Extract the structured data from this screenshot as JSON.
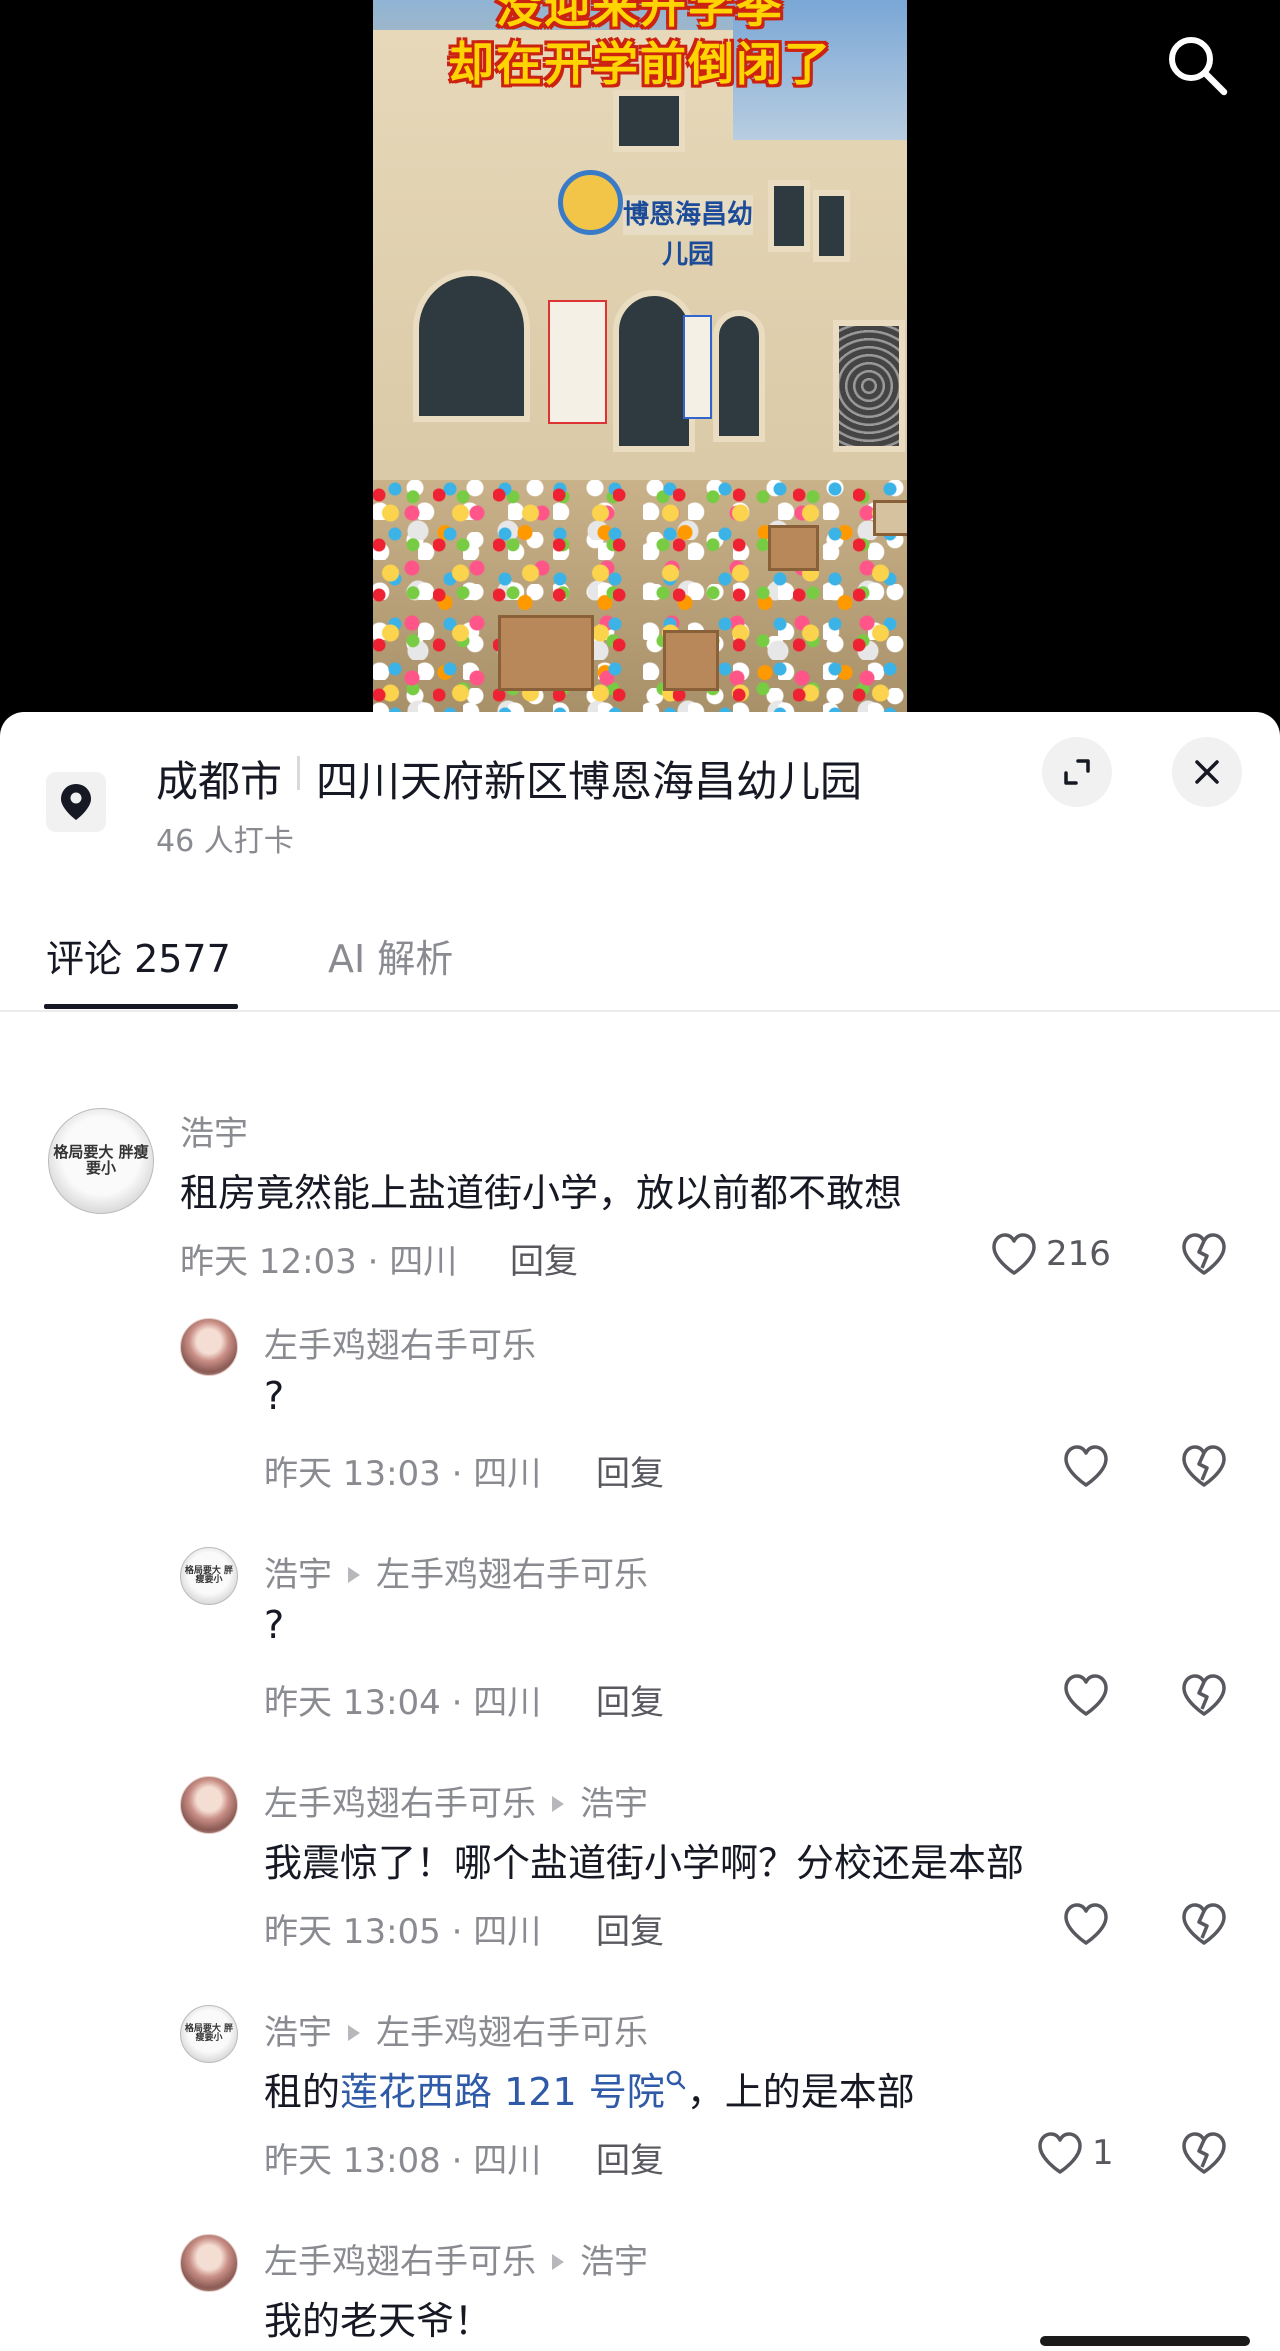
{
  "video": {
    "caption_line1": "没迎来开学季",
    "caption_line2": "却在开学前倒闭了",
    "sign_text": "博恩海昌幼儿园",
    "search_icon": "search-icon"
  },
  "location": {
    "icon": "location-pin-icon",
    "city": "成都市",
    "name": "四川天府新区博恩海昌幼儿园",
    "checkins": "46 人打卡",
    "expand_icon": "expand-icon",
    "close_icon": "close-icon"
  },
  "tabs": [
    {
      "label": "评论 2577",
      "active": true
    },
    {
      "label": "AI 解析",
      "active": false
    }
  ],
  "comments": [
    {
      "user": "浩宇",
      "reply_to": "",
      "avatar": "calligraphy-avatar",
      "avatar_text": "格局要大 胖瘦要小",
      "text": "租房竟然能上盐道街小学，放以前都不敢想",
      "time": "昨天 12:03 · 四川",
      "reply_label": "回复",
      "likes": "216"
    },
    {
      "user": "左手鸡翅右手可乐",
      "reply_to": "",
      "avatar": "girl-avatar",
      "text": "?",
      "time": "昨天 13:03 · 四川",
      "reply_label": "回复",
      "likes": ""
    },
    {
      "user": "浩宇",
      "reply_to": "左手鸡翅右手可乐",
      "avatar": "calligraphy-avatar",
      "avatar_text": "格局要大 胖瘦要小",
      "text": "?",
      "time": "昨天 13:04 · 四川",
      "reply_label": "回复",
      "likes": ""
    },
    {
      "user": "左手鸡翅右手可乐",
      "reply_to": "浩宇",
      "avatar": "girl-avatar",
      "text": "我震惊了！哪个盐道街小学啊？分校还是本部",
      "time": "昨天 13:05 · 四川",
      "reply_label": "回复",
      "likes": ""
    },
    {
      "user": "浩宇",
      "reply_to": "左手鸡翅右手可乐",
      "avatar": "calligraphy-avatar",
      "avatar_text": "格局要大 胖瘦要小",
      "text_prefix": "租的",
      "text_link": "莲花西路 121 号院",
      "text_suffix": "，上的是本部",
      "time": "昨天 13:08 · 四川",
      "reply_label": "回复",
      "likes": "1"
    },
    {
      "user": "左手鸡翅右手可乐",
      "reply_to": "浩宇",
      "avatar": "girl-avatar",
      "text": "我的老天爷！",
      "time": "",
      "reply_label": "",
      "likes": ""
    }
  ],
  "colors": {
    "caption_yellow": "#ffd400",
    "caption_outline": "#cc2211",
    "link_blue": "#2f5aa8",
    "muted_text": "#8a8b91",
    "primary_text": "#161823"
  }
}
